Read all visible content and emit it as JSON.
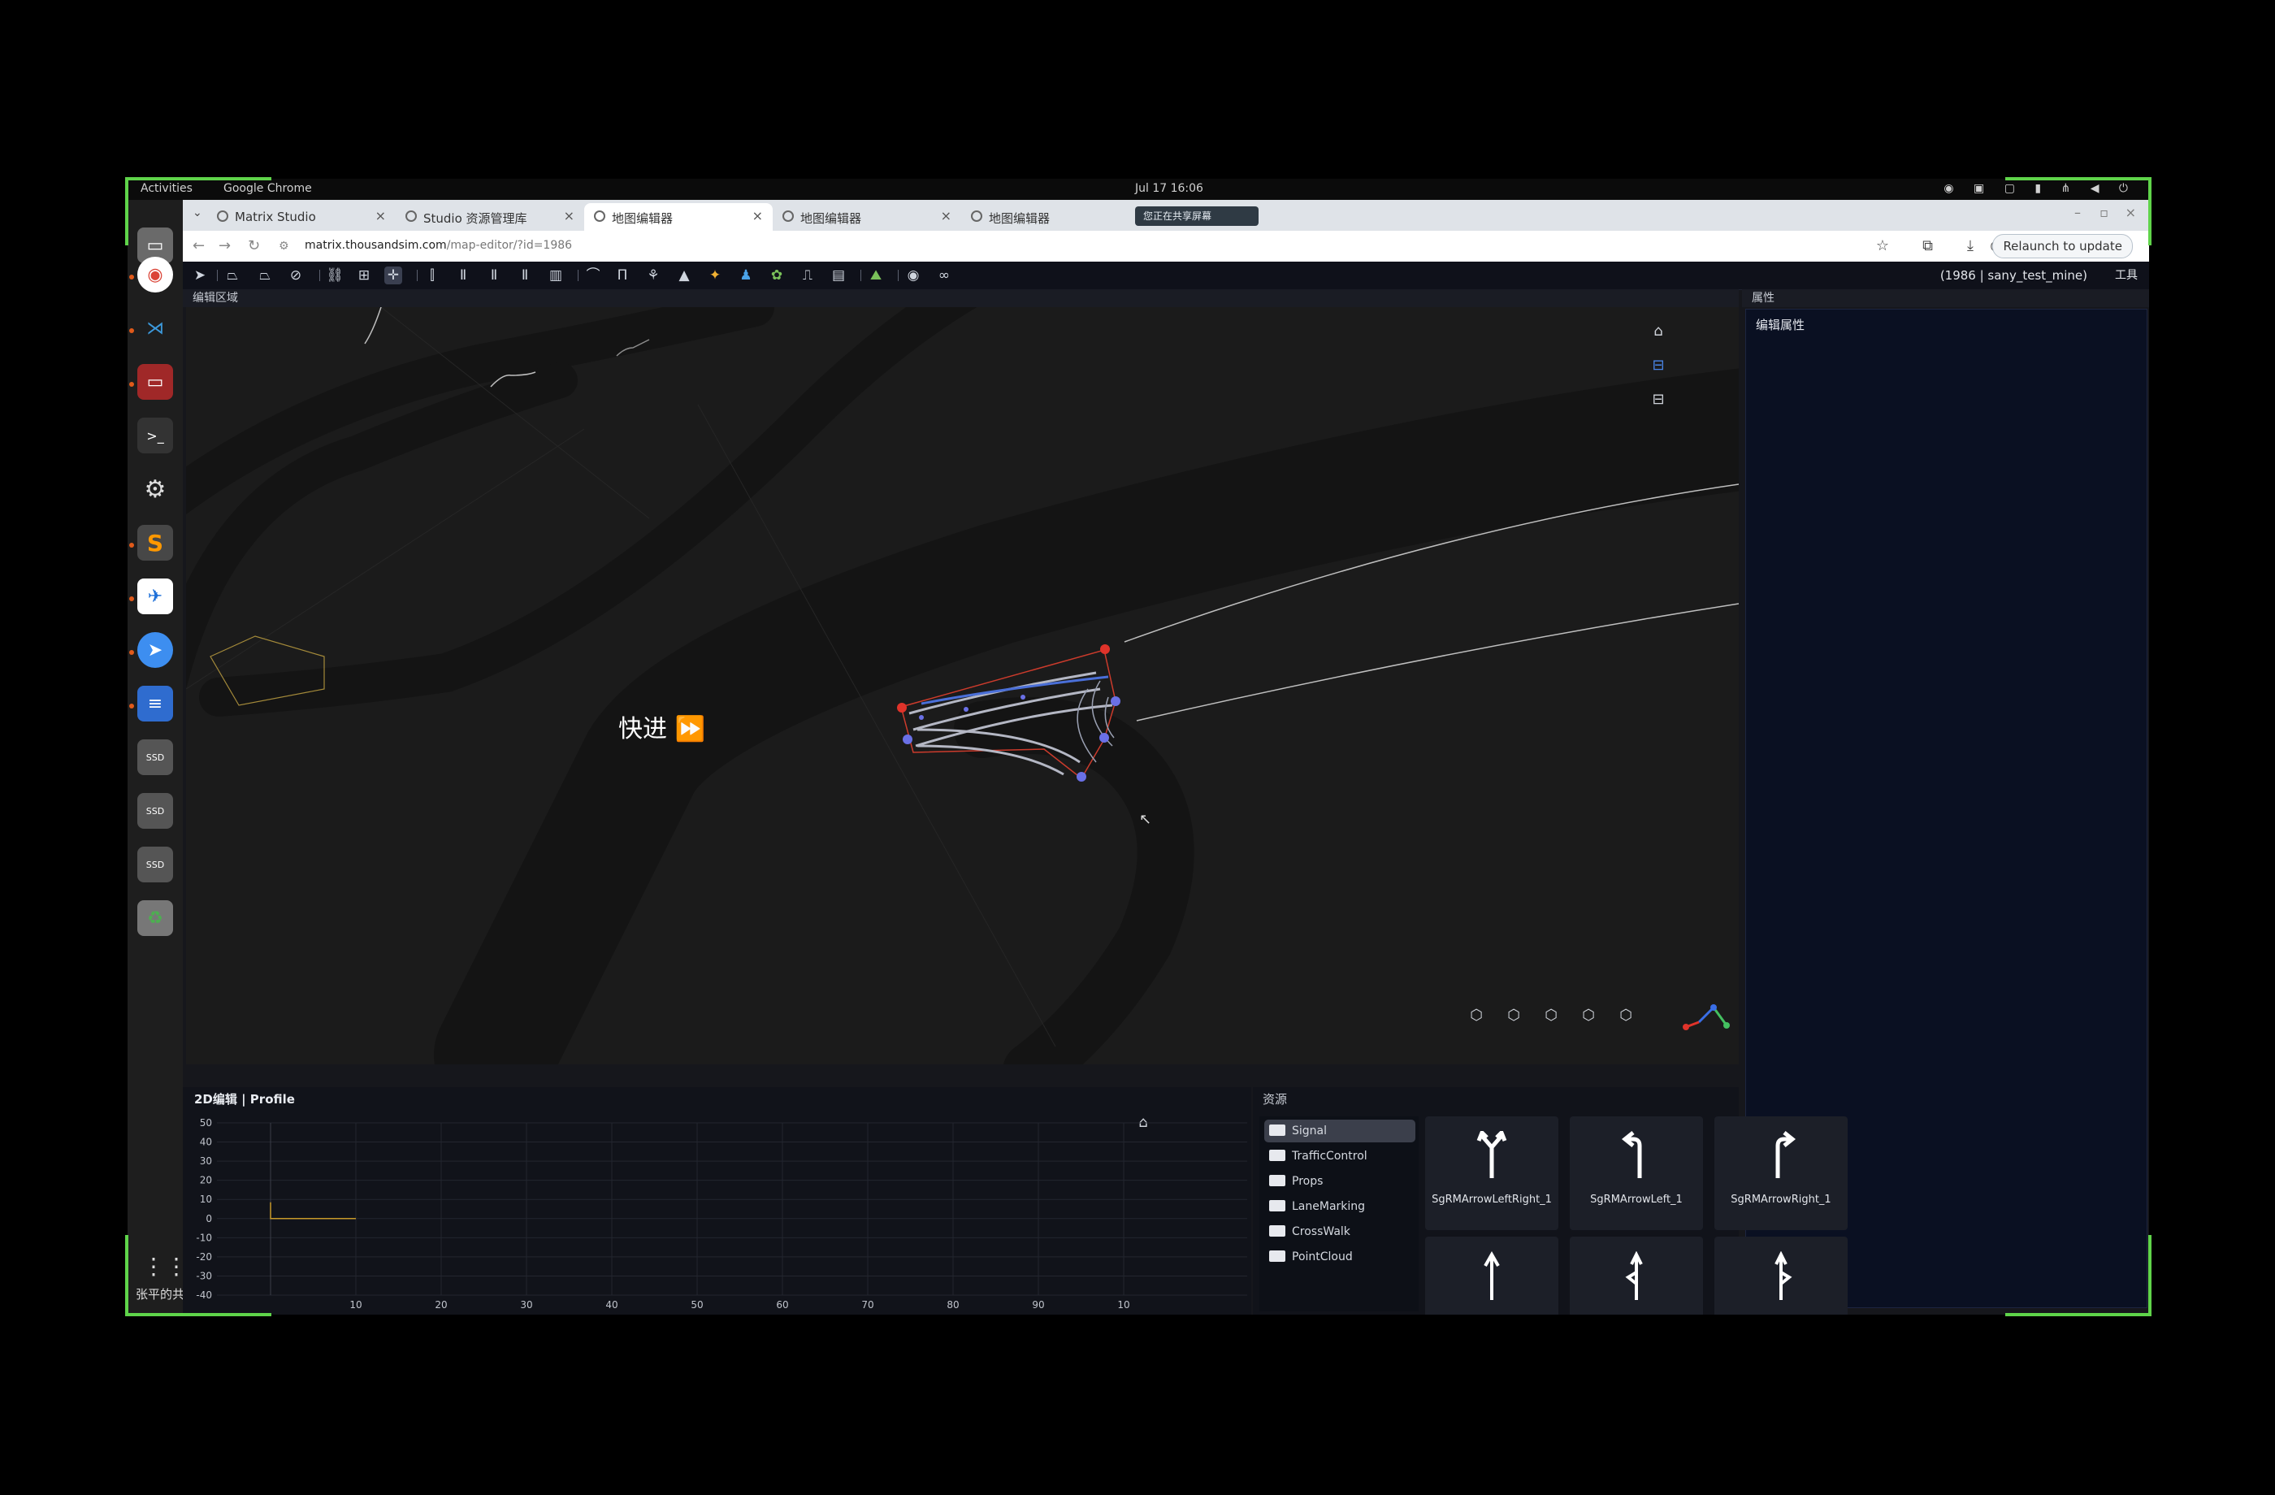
{
  "system_bar": {
    "activities": "Activities",
    "app_name": "Google Chrome",
    "clock": "Jul 17  16:06"
  },
  "dock": {
    "share_caption": "张平的共享屏幕",
    "apps": [
      "chrome-icon",
      "vscode-icon",
      "screen-recorder-icon",
      "terminal-icon",
      "settings-icon",
      "sublime-icon",
      "feishu-icon",
      "messenger-icon",
      "document-icon",
      "ssd-icon",
      "ssd-icon",
      "ssd-icon",
      "recycle-icon"
    ]
  },
  "browser": {
    "tabs": [
      {
        "label": "Matrix Studio"
      },
      {
        "label": "Studio 资源管理库"
      },
      {
        "label": "地图编辑器"
      },
      {
        "label": "地图编辑器"
      },
      {
        "label": "地图编辑器"
      }
    ],
    "sharing_badge": "您正在共享屏幕",
    "url_domain": "matrix.thousandsim.com",
    "url_path": "/map-editor/?id=1986",
    "relaunch": "Relaunch to update"
  },
  "app": {
    "project": "(1986 | sany_test_mine)",
    "tools_label": "工具",
    "edit_area_title": "编辑区域",
    "fast_forward": "快进",
    "properties_title": "属性",
    "edit_properties": "编辑属性",
    "profile_title": "2D编辑 | Profile",
    "profile_chart": {
      "y_ticks": [
        "50",
        "40",
        "30",
        "20",
        "10",
        "0",
        "-10",
        "-20",
        "-30",
        "-40"
      ],
      "x_ticks": [
        "10",
        "20",
        "30",
        "40",
        "50",
        "60",
        "70",
        "80",
        "90",
        "10"
      ]
    },
    "resources_title": "资源",
    "folders": [
      "Signal",
      "TrafficControl",
      "Props",
      "LaneMarking",
      "CrossWalk",
      "PointCloud"
    ],
    "assets": [
      {
        "name": "SgRMArrowLeftRight_1"
      },
      {
        "name": "SgRMArrowLeft_1"
      },
      {
        "name": "SgRMArrowRight_1"
      },
      {
        "name": ""
      },
      {
        "name": ""
      },
      {
        "name": ""
      }
    ]
  }
}
